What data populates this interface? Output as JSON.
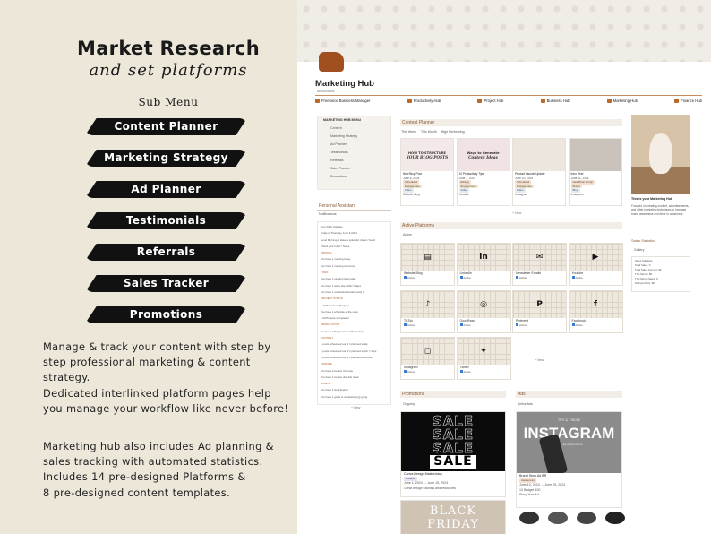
{
  "promo": {
    "title": "Market Research",
    "subtitle": "and set platforms",
    "submenu_label": "Sub Menu",
    "menu": [
      "Content Planner",
      "Marketing Strategy",
      "Ad Planner",
      "Testimonials",
      "Referrals",
      "Sales Tracker",
      "Promotions"
    ],
    "para1": [
      "Manage & track your content with step by",
      "step professional marketing & content",
      "strategy.",
      "Dedicated interlinked platform pages help",
      "you manage your workflow like never before!"
    ],
    "para2": [
      "Marketing hub also includes Ad planning &",
      "sales tracking with automated statistics.",
      "Includes 14 pre-designed Platforms &",
      "8 pre-designed content templates."
    ]
  },
  "app": {
    "page_title": "Marketing Hub",
    "page_sub": "All functions",
    "nav": [
      "Freelance Business Manager",
      "Productivity Hub",
      "Project Hub",
      "Business Hub",
      "Marketing Hub",
      "Finance Hub"
    ],
    "sidebar_menu_title": "MARKETING HUB MENU",
    "sidebar_menu": [
      "Content",
      "Marketing Strategy",
      "Ad Planner",
      "Testimonials",
      "Referrals",
      "Sales Tracker",
      "Promotions"
    ],
    "personal_assistant": "Personal Assistant",
    "notifications": "Notifications",
    "pa_lines": [
      "Your Daily Updates",
      "Today is Thursday, June 6 2024",
      "Good Morning & Have a splendid, dream Yours!",
      "Check your Inbox / Notes",
      "WRITING",
      "You have 1 meeting today",
      "You have 1 meeting tomorrow",
      "TODO",
      "You have 1 pending task today",
      "You have 1 tasks due within 7 days",
      "You have 1 unscheduled task, verify it",
      "PROJECT STATUS",
      "1 All Projects in Progress",
      "You have 1 schedule at the ones",
      "1 All Projects Completed",
      "PRODUCTIVITY",
      "You have 1 Progressive within 7 days",
      "CONTENT",
      "1 posts scheduled out of 1 planned today",
      "1 posts scheduled out of 1 planned within 7 days",
      "1 posts scheduled out of 1 planned tomorrow",
      "FINANCE",
      "You have 0 invoice Overdue",
      "You have 1 invoice due this week",
      "GOALS",
      "You have 1 Goal Ended",
      "You have 1 goals to complete (ing) going"
    ],
    "new_label": "+ New",
    "content_planner": "Content Planner",
    "cp_tabs": [
      "This Week",
      "This Month",
      "High Performing"
    ],
    "cp_cards": [
      {
        "title": "New Blog Post",
        "date": "June 6, 2024",
        "tag1": "Scheduled",
        "tag2": "Engagement",
        "tag3": "Video",
        "foot": "Website Blog",
        "thumb_t1": "HOW TO STRUCTURE",
        "thumb_t2": "YOUR BLOG POSTS"
      },
      {
        "title": "10 Productivity Tips",
        "date": "June 7, 2024",
        "tag1": "Editing",
        "tag2": "Engagement",
        "tag3": "Video",
        "foot": "Youtube",
        "thumb_t1": "Ways to Generate",
        "thumb_t2": "Content Ideas"
      },
      {
        "title": "Product Launch Update",
        "date": "June 10, 2024",
        "tag1": "Scheduled",
        "tag2": "Engagement",
        "tag3": "Video",
        "foot": "Instagram",
        "thumb_t1": "",
        "thumb_t2": ""
      },
      {
        "title": "Intro Reel",
        "date": "June 11, 2024",
        "tag1": "Idea Brain Dump",
        "tag2": "Brand",
        "tag3": "Blog",
        "foot": "Instagram",
        "thumb_t1": "",
        "thumb_t2": ""
      }
    ],
    "active_platforms": "Active Platforms",
    "ap_view": "Active",
    "platforms": [
      {
        "name": "Website Blog",
        "icon": "▤",
        "status": "Active"
      },
      {
        "name": "LinkedIn",
        "icon": "in",
        "status": "Active"
      },
      {
        "name": "Newsletter Emails",
        "icon": "✉",
        "status": "Active"
      },
      {
        "name": "Youtube",
        "icon": "▶",
        "status": "Active"
      },
      {
        "name": "TikTok",
        "icon": "♪",
        "status": "Active"
      },
      {
        "name": "GoodRead",
        "icon": "◎",
        "status": "Active"
      },
      {
        "name": "Pinterest",
        "icon": "P",
        "status": "Active"
      },
      {
        "name": "Facebook",
        "icon": "f",
        "status": "Active"
      },
      {
        "name": "Instagram",
        "icon": "◻",
        "status": "Active"
      },
      {
        "name": "Twitter",
        "icon": "✦",
        "status": "Active"
      }
    ],
    "promotions": "Promotions",
    "promo_view": "Ongoing",
    "promo_card_title": "Canva Design Masterclass",
    "promo_card_date": "June 1, 2024 → June 15, 2024",
    "promo_card_tag": "Creative",
    "promo_card_desc": "Great design tutorials and resources",
    "sale_word": "SALE",
    "black_friday_1": "BLACK",
    "black_friday_2": "FRIDAY",
    "ads": "Ads",
    "ads_view": "Active Ads",
    "ad_card_title": "Brand Story Ad BR",
    "ad_card_date1": "June 10, 2024 → June 25, 2024",
    "ad_card_tag": "Awareness",
    "ad_card_budget": "10 Budget 100",
    "ad_card_foot": "Story Yum Ad",
    "insta_word": "INSTAGRAM",
    "insta_top": "TIPS & TRICKS",
    "insta_bottom": "FOR BUSINESSES",
    "right_caption": "This is your Marketing Hub",
    "right_desc": "Focuses on creating content, advertisements, and other marketing techniques to increase brand awareness and drive in customers.",
    "sales_stats": "Sales Statistics",
    "sales_view": "Gallery",
    "sales_lines": [
      "Sales Statistics",
      "Total Sales: 0",
      "Total Sales Amount: $0",
      "This Month: $0",
      "This Month Sales: 0",
      "Highest Price: $0"
    ]
  }
}
